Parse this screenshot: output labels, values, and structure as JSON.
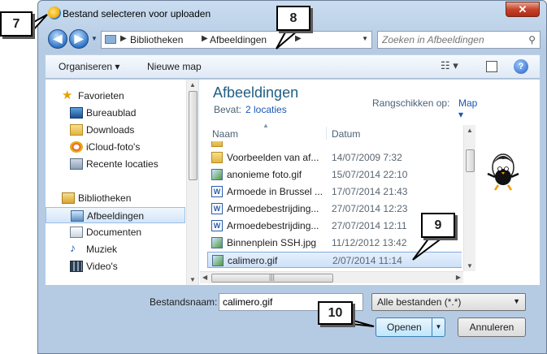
{
  "window": {
    "title": "Bestand selecteren voor uploaden",
    "close_label": "✕"
  },
  "nav": {
    "breadcrumb": [
      "Bibliotheken",
      "Afbeeldingen"
    ],
    "search_placeholder": "Zoeken in Afbeeldingen"
  },
  "toolbar": {
    "organize_label": "Organiseren ▾",
    "new_folder_label": "Nieuwe map",
    "view_icon": "☷ ▾",
    "help_label": "?"
  },
  "sidebar": {
    "favorites": {
      "label": "Favorieten",
      "icon": "star-icon"
    },
    "favorite_items": [
      {
        "label": "Bureaublad",
        "icon": "desktop-icon"
      },
      {
        "label": "Downloads",
        "icon": "downloads-icon"
      },
      {
        "label": "iCloud-foto's",
        "icon": "icloud-icon"
      },
      {
        "label": "Recente locaties",
        "icon": "recent-places-icon"
      }
    ],
    "libraries": {
      "label": "Bibliotheken",
      "icon": "libraries-icon"
    },
    "library_items": [
      {
        "label": "Afbeeldingen",
        "icon": "pictures-icon",
        "selected": true
      },
      {
        "label": "Documenten",
        "icon": "documents-icon"
      },
      {
        "label": "Muziek",
        "icon": "music-icon"
      },
      {
        "label": "Video's",
        "icon": "videos-icon"
      }
    ]
  },
  "library": {
    "title": "Afbeeldingen",
    "includes_label": "Bevat:",
    "includes_link": "2 locaties",
    "arrange_label": "Rangschikken op:",
    "arrange_value": "Map ▾"
  },
  "columns": {
    "name": "Naam",
    "date": "Datum"
  },
  "files": [
    {
      "name": "Voorbeelden van af...",
      "date": "14/07/2009 7:32",
      "type": "folder"
    },
    {
      "name": "anonieme foto.gif",
      "date": "15/07/2014 22:10",
      "type": "image"
    },
    {
      "name": "Armoede in Brussel ...",
      "date": "17/07/2014 21:43",
      "type": "word"
    },
    {
      "name": "Armoedebestrijding...",
      "date": "27/07/2014 12:23",
      "type": "word"
    },
    {
      "name": "Armoedebestrijding...",
      "date": "27/07/2014 12:11",
      "type": "word"
    },
    {
      "name": "Binnenplein SSH.jpg",
      "date": "11/12/2012 13:42",
      "type": "image"
    },
    {
      "name": "calimero.gif",
      "date": "2/07/2014 11:14",
      "type": "image",
      "selected": true
    }
  ],
  "bottom": {
    "filename_label": "Bestandsnaam:",
    "filename_value": "calimero.gif",
    "filetype_value": "Alle bestanden (*.*)",
    "open_label": "Openen",
    "cancel_label": "Annuleren"
  },
  "callouts": [
    "7",
    "8",
    "9",
    "10"
  ]
}
